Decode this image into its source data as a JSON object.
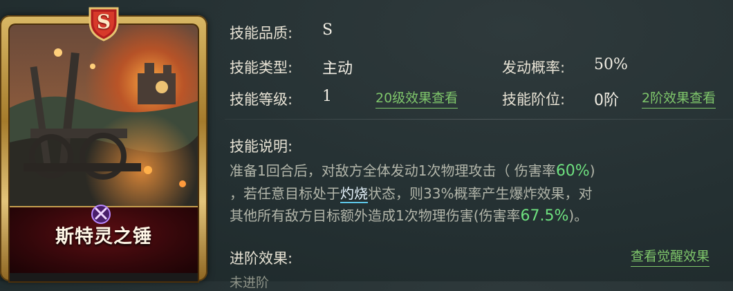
{
  "card": {
    "grade": "S",
    "name": "斯特灵之锤"
  },
  "info": {
    "quality_label": "技能品质:",
    "quality_value": "S",
    "type_label": "技能类型:",
    "type_value": "主动",
    "trigger_label": "发动概率:",
    "trigger_value": "50%",
    "level_label": "技能等级:",
    "level_value": "1",
    "level_link": "20级效果查看",
    "rank_label": "技能阶位:",
    "rank_value": "0阶",
    "rank_link": "2阶效果查看"
  },
  "description": {
    "label": "技能说明:",
    "line1_prefix": "准备1回合后，对敌方全体发动1次物理攻击（ 伤害率",
    "line1_value": "60%",
    "line1_suffix": ")",
    "line2_prefix": "，若任意目标处于",
    "line2_keyword": "灼烧",
    "line2_suffix": "状态，则33%概率产生爆炸效果，对",
    "line3_prefix": "其他所有敌方目标额外造成1次物理伤害(伤害率",
    "line3_value": "67.5%",
    "line3_suffix": ")。"
  },
  "advance": {
    "label": "进阶效果:",
    "link": "查看觉醒效果",
    "text": "未进阶"
  },
  "colors": {
    "highlight_green": "#6ee07f",
    "link_green": "#7fc76b",
    "keyword_underline": "#5ec7e8",
    "card_gold": "#d9b865",
    "name_plate_red": "#5a0d12"
  }
}
